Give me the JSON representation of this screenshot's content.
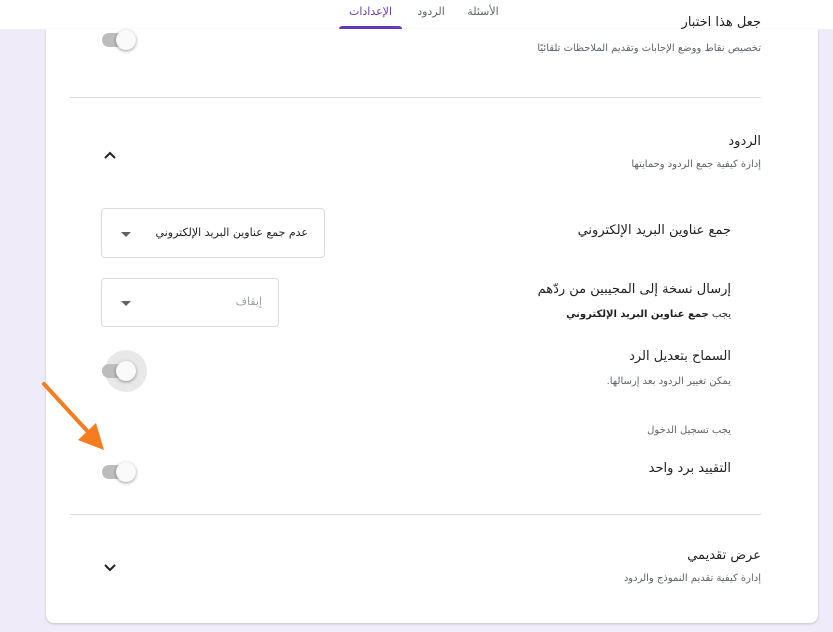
{
  "tabs": {
    "questions": "الأسئلة",
    "responses": "الردود",
    "settings": "الإعدادات"
  },
  "quiz": {
    "title_partial": "جعل هذا اختبار",
    "desc": "تخصيص نقاط ووضع الإجابات وتقديم الملاحظات تلقائيًا"
  },
  "responses_section": {
    "title": "الردود",
    "desc": "إدارة كيفية جمع الردود وحمايتها",
    "collect_emails": {
      "label": "جمع عناوين البريد الإلكتروني",
      "value": "عدم جمع عناوين البريد الإلكتروني"
    },
    "send_copy": {
      "label": "إرسال نسخة إلى المجيبين من ردّهم",
      "hint_prefix": "يجب",
      "hint_bold": "جمع عناوين البريد الإلكتروني",
      "value": "إيقاف"
    },
    "allow_edit": {
      "label": "السماح بتعديل الرد",
      "desc": "يمكن تغيير الردود بعد إرسالها."
    },
    "requires_signin": "يجب تسجيل الدخول",
    "limit_one": {
      "label": "التقييد برد واحد"
    }
  },
  "presentation_section": {
    "title": "عرض تقديمي",
    "desc": "إدارة كيفية تقديم النموذج والردود"
  },
  "colors": {
    "accent": "#673ab7",
    "background": "#f0ebf8",
    "annotation_arrow": "#f57c1f"
  }
}
